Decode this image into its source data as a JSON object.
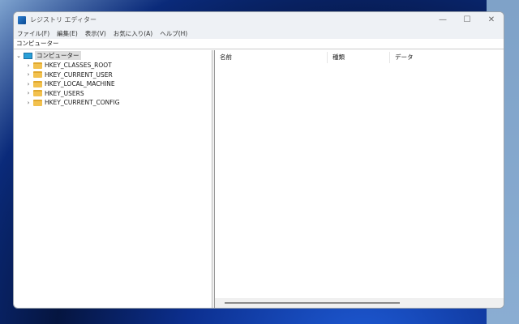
{
  "window": {
    "title": "レジストリ エディター",
    "minimize": "—",
    "maximize": "☐",
    "close": "✕"
  },
  "menu": [
    "ファイル(F)",
    "編集(E)",
    "表示(V)",
    "お気に入り(A)",
    "ヘルプ(H)"
  ],
  "address": "コンピューター",
  "tree": {
    "root": "コンピューター",
    "children": [
      "HKEY_CLASSES_ROOT",
      "HKEY_CURRENT_USER",
      "HKEY_LOCAL_MACHINE",
      "HKEY_USERS",
      "HKEY_CURRENT_CONFIG"
    ]
  },
  "columns": [
    "名前",
    "種類",
    "データ"
  ]
}
